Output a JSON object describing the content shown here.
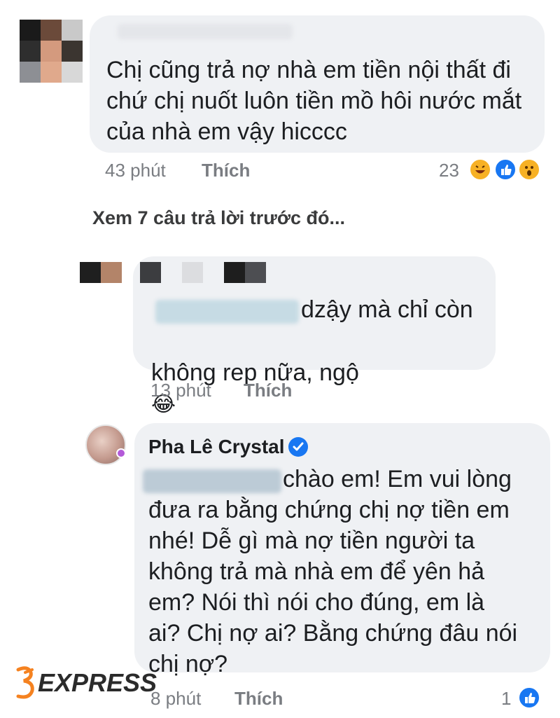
{
  "comment1": {
    "text": "Chị cũng trả nợ nhà em tiền nội thất đi\nchứ chị nuốt luôn tiền mồ hôi nước mắt\ncủa nhà em vậy hicccc",
    "time": "43 phút",
    "like_label": "Thích",
    "reaction_count": "23",
    "reaction_icons": [
      "haha-icon",
      "like-icon",
      "wow-icon"
    ]
  },
  "view_previous_replies": "Xem 7 câu trả lời trước đó...",
  "reply1": {
    "text_visible": "dzậy mà chỉ còn",
    "text_line2": "không rep nữa, ngộ",
    "emoji": "😂",
    "time": "13 phút",
    "like_label": "Thích"
  },
  "reply2": {
    "author": "Pha Lê Crystal",
    "verified_icon": "verified-badge-icon",
    "text_line1": "chào em! Em vui lòng",
    "text_rest": "đưa ra bằng chứng chị nợ tiền em\nnhé! Dễ gì mà nợ tiền người ta\nkhông trả mà nhà em để yên hả\nem? Nói thì nói cho đúng, em là\nai? Chị nợ ai? Bằng chứng đâu nói\nchị nợ?",
    "time": "8 phút",
    "like_label": "Thích",
    "reaction_count": "1",
    "reaction_icons": [
      "like-icon"
    ]
  },
  "watermark": "EXPRESS",
  "colors": {
    "bubble": "#eff1f4",
    "meta_text": "#7a7d82",
    "facebook_blue": "#1877f2",
    "watermark_orange": "#f58220"
  }
}
